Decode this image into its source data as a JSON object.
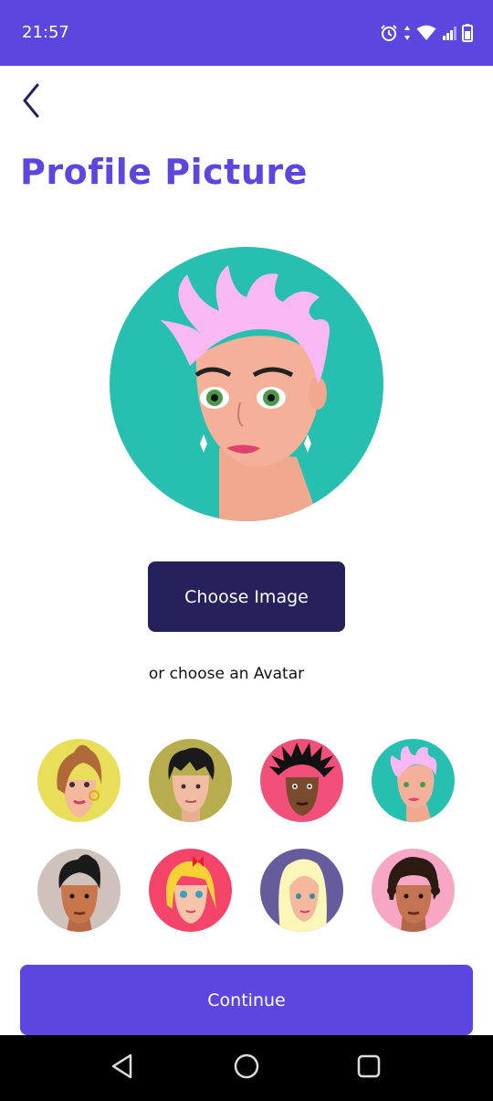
{
  "status_bar": {
    "time": "21:57",
    "icons": [
      "alarm-icon",
      "data-transfer-icon",
      "wifi-icon",
      "signal-icon",
      "battery-icon"
    ]
  },
  "header": {
    "back_icon": "chevron-left-icon",
    "title": "Profile Picture"
  },
  "profile": {
    "selected_avatar": "avatar-pink-short-hair"
  },
  "actions": {
    "choose_image_label": "Choose Image",
    "or_text": "or choose an Avatar",
    "continue_label": "Continue"
  },
  "avatars": [
    {
      "id": "avatar-brown-bun",
      "bg": "#e8de5a"
    },
    {
      "id": "avatar-black-spiky",
      "bg": "#b8ad4e"
    },
    {
      "id": "avatar-dreadlocks",
      "bg": "#f0507a"
    },
    {
      "id": "avatar-pink-short-hair",
      "bg": "#26bfb0"
    },
    {
      "id": "avatar-dark-quiff",
      "bg": "#cfc2bc"
    },
    {
      "id": "avatar-blonde-bow",
      "bg": "#f5446a"
    },
    {
      "id": "avatar-platinum-long",
      "bg": "#665b9c"
    },
    {
      "id": "avatar-curly-dark",
      "bg": "#f7a6c4"
    }
  ],
  "colors": {
    "accent": "#5c46e0",
    "dark_button": "#25215a",
    "nav_bar": "#000000"
  },
  "nav": {
    "icons": [
      "back-triangle-icon",
      "home-circle-icon",
      "recents-square-icon"
    ]
  }
}
